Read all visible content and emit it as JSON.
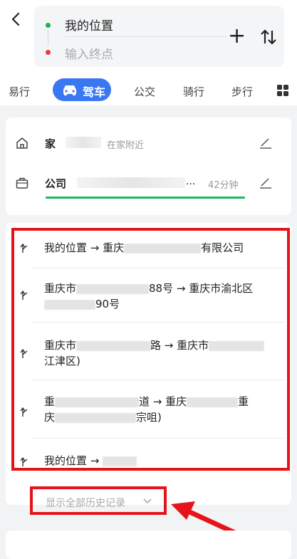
{
  "header": {
    "start_label": "我的位置",
    "end_placeholder": "输入终点",
    "plus_symbol": "+"
  },
  "modes": [
    {
      "label": "易行"
    },
    {
      "label": "驾车",
      "active": true
    },
    {
      "label": "公交"
    },
    {
      "label": "骑行"
    },
    {
      "label": "步行"
    }
  ],
  "favorites": {
    "home": {
      "label": "家",
      "hint": "在家附近"
    },
    "company": {
      "label": "公司",
      "eta": "42分钟",
      "ellipsis": "..."
    }
  },
  "history": [
    {
      "prefix": "我的位置 → 重庆",
      "suffix": "有限公司"
    },
    {
      "line1_prefix": "重庆市",
      "line1_mid": "88号 → 重庆市渝北区",
      "line2_suffix": "90号"
    },
    {
      "line1_prefix": "重庆市",
      "line1_mid": "路 → 重庆市",
      "line2": "江津区)"
    },
    {
      "line1_prefix": "重",
      "line1_mid": "道 → 重庆",
      "line1_end": "重",
      "line2_prefix": "庆",
      "line2_suffix": "宗咀)"
    },
    {
      "prefix": "我的位置 → "
    }
  ],
  "show_all_label": "显示全部历史记录",
  "colors": {
    "accent": "#3a78f2",
    "highlight": "#e5141b",
    "traffic": "#1fb85c"
  }
}
